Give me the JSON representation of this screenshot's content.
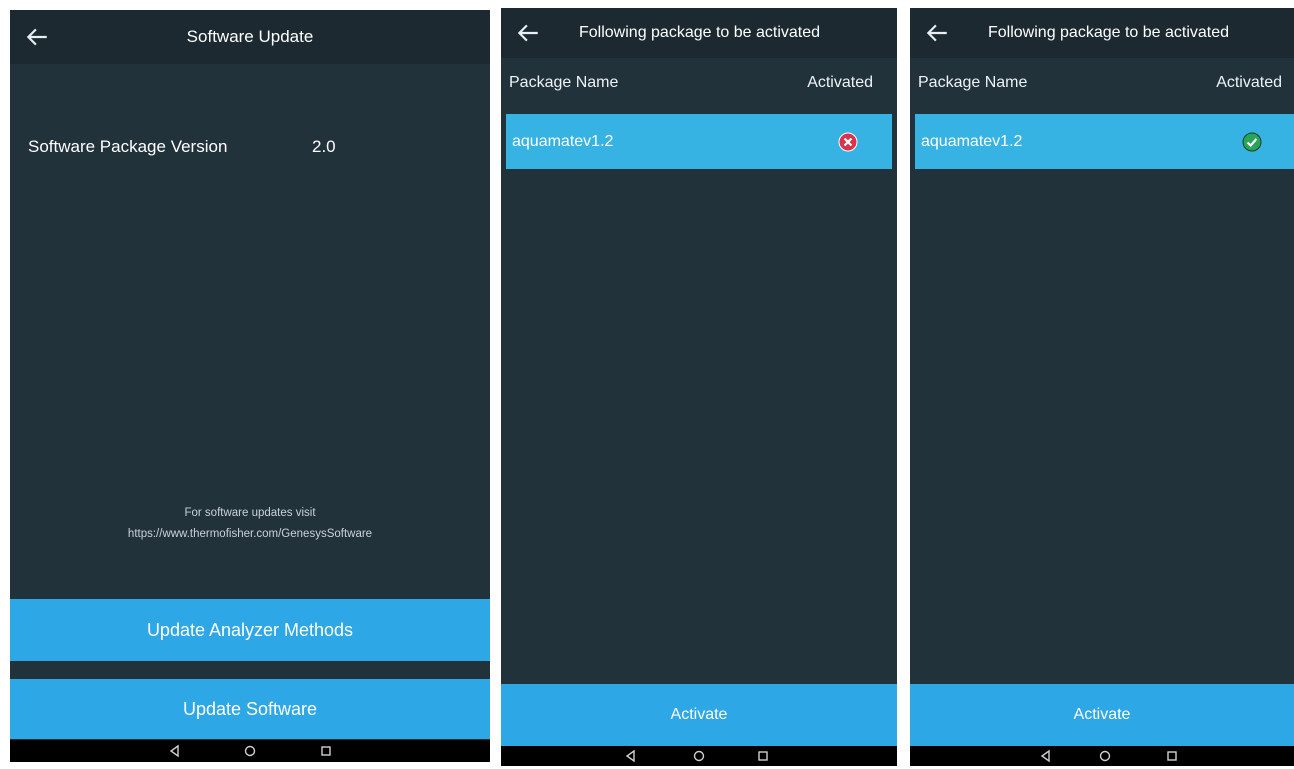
{
  "screen1": {
    "back_icon": "arrow-left-icon",
    "title": "Software Update",
    "version_label": "Software Package Version",
    "version_value": "2.0",
    "footer_line1": "For software updates visit",
    "footer_line2": "https://www.thermofisher.com/GenesysSoftware",
    "button_methods": "Update Analyzer Methods",
    "button_software": "Update Software"
  },
  "screen2": {
    "back_icon": "arrow-left-icon",
    "title": "Following package to be activated",
    "col_name": "Package Name",
    "col_activated": "Activated",
    "package": "aquamatev1.2",
    "status_icon": "error-x-icon",
    "button": "Activate"
  },
  "screen3": {
    "back_icon": "arrow-left-icon",
    "title": "Following package to be activated",
    "col_name": "Package Name",
    "col_activated": "Activated",
    "package": "aquamatev1.2",
    "status_icon": "check-circle-icon",
    "button": "Activate"
  },
  "navbar": {
    "back_icon": "nav-back-triangle-icon",
    "home_icon": "nav-home-circle-icon",
    "recents_icon": "nav-recents-square-icon"
  },
  "colors": {
    "background": "#22323b",
    "topbar": "#1c2931",
    "accent_button": "#2ea7e6",
    "selected_row": "#36b3e2",
    "error": "#d9344a",
    "success": "#27a65a"
  }
}
